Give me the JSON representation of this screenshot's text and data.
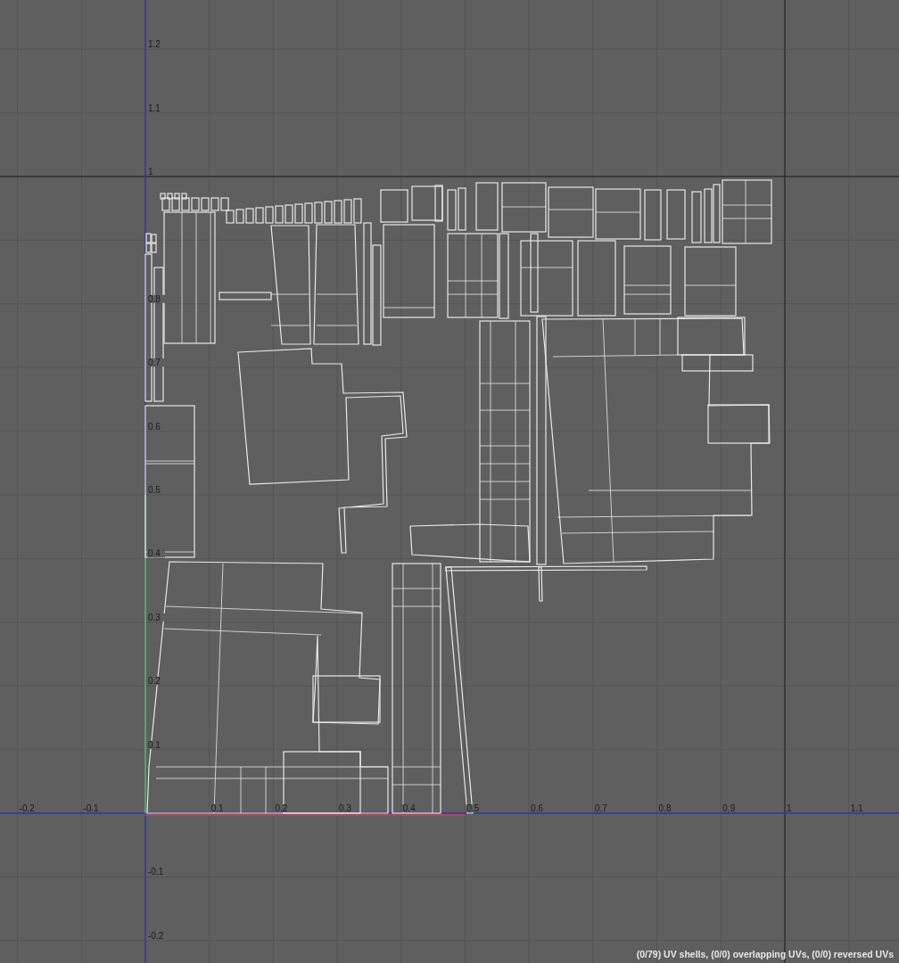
{
  "viewport": {
    "u_labels": [
      "-0.2",
      "-0.1",
      "0.1",
      "0.2",
      "0.3",
      "0.4",
      "0.5",
      "0.6",
      "0.7",
      "0.8",
      "0.9",
      "1",
      "1.1"
    ],
    "v_labels": [
      "1.2",
      "1.1",
      "1",
      "0.8",
      "0.7",
      "0.6",
      "0.5",
      "0.4",
      "0.3",
      "0.2",
      "0.1",
      "-0.1",
      "-0.2"
    ]
  },
  "status": "(0/79) UV shells, (0/0) overlapping UVs, (0/0) reversed UVs"
}
